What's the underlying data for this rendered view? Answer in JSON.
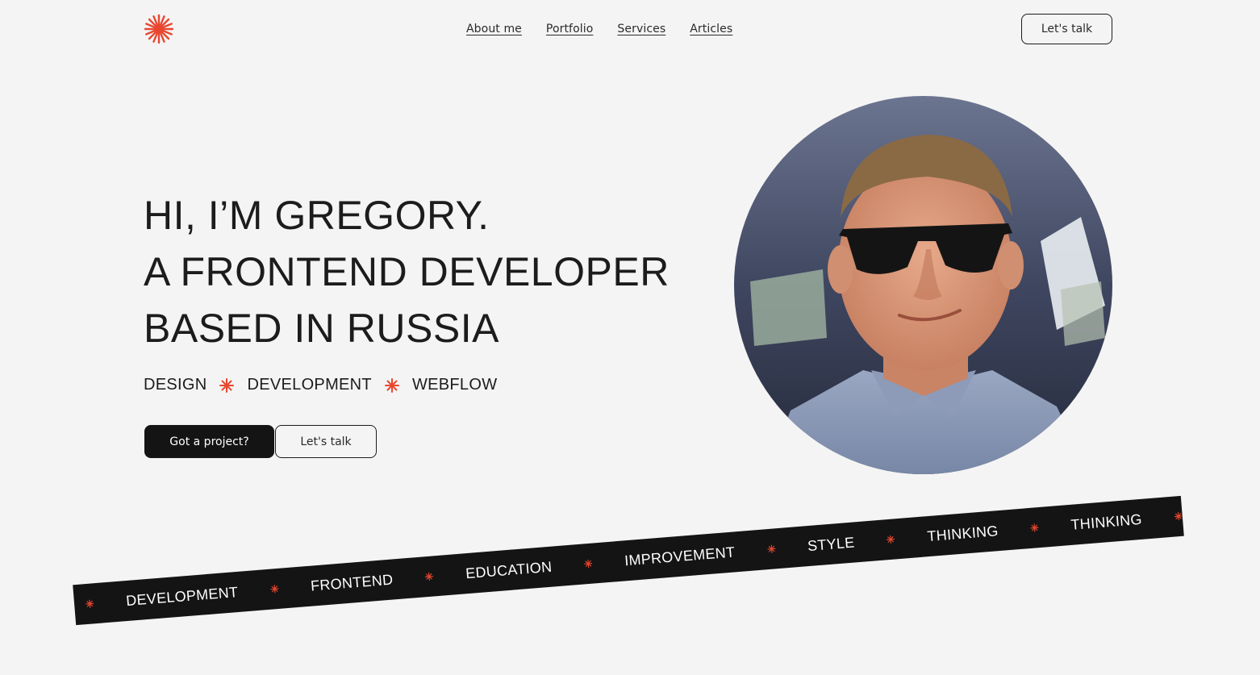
{
  "header": {
    "logo": "sunburst-logo",
    "nav": [
      {
        "label": "About me"
      },
      {
        "label": "Portfolio"
      },
      {
        "label": "Services"
      },
      {
        "label": "Articles"
      }
    ],
    "cta_label": "Let's talk"
  },
  "hero": {
    "title_lines": [
      "HI, I’M GREGORY.",
      "A FRONTEND DEVELOPER",
      "BASED IN RUSSIA"
    ],
    "skills": [
      "DESIGN",
      "DEVELOPMENT",
      "WEBFLOW"
    ],
    "primary_button": "Got a project?",
    "secondary_button": "Let's talk",
    "portrait": "portrait-photo"
  },
  "band": {
    "words": [
      "DEVELOPMENT",
      "FRONTEND",
      "EDUCATION",
      "IMPROVEMENT",
      "STYLE",
      "THINKING",
      "THINKING"
    ]
  },
  "colors": {
    "background": "#f4f4f4",
    "accent": "#e8472f",
    "dark": "#141414",
    "text": "#1c1c1c"
  }
}
